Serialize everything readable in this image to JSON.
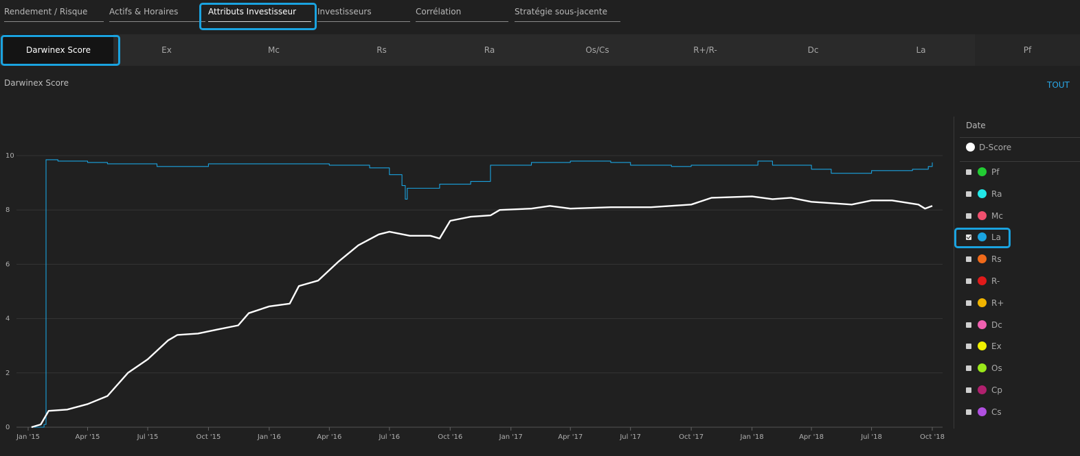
{
  "top_tabs": [
    {
      "label": "Rendement / Risque"
    },
    {
      "label": "Actifs & Horaires"
    },
    {
      "label": "Attributs Investisseur"
    },
    {
      "label": "Investisseurs"
    },
    {
      "label": "Corrélation"
    },
    {
      "label": "Stratégie sous-jacente"
    }
  ],
  "sub_tabs": [
    {
      "label": "Darwinex Score"
    },
    {
      "label": "Ex"
    },
    {
      "label": "Mc"
    },
    {
      "label": "Rs"
    },
    {
      "label": "Ra"
    },
    {
      "label": "Os/Cs"
    },
    {
      "label": "R+/R-"
    },
    {
      "label": "Dc"
    },
    {
      "label": "La"
    },
    {
      "label": "Pf"
    }
  ],
  "chart_panel": {
    "title": "Darwinex Score",
    "tout_label": "TOUT"
  },
  "legend": {
    "date_label": "Date",
    "dscore_label": "D-Score",
    "items": [
      {
        "label": "Pf",
        "color": "#22cc33",
        "checked": false
      },
      {
        "label": "Ra",
        "color": "#22e8e8",
        "checked": false
      },
      {
        "label": "Mc",
        "color": "#f0506e",
        "checked": false
      },
      {
        "label": "La",
        "color": "#1aa3e0",
        "checked": true
      },
      {
        "label": "Rs",
        "color": "#f06a1a",
        "checked": false
      },
      {
        "label": "R-",
        "color": "#e01a1a",
        "checked": false
      },
      {
        "label": "R+",
        "color": "#f0b400",
        "checked": false
      },
      {
        "label": "Dc",
        "color": "#f060b0",
        "checked": false
      },
      {
        "label": "Ex",
        "color": "#f0f000",
        "checked": false
      },
      {
        "label": "Os",
        "color": "#9ae81a",
        "checked": false
      },
      {
        "label": "Cp",
        "color": "#b0206e",
        "checked": false
      },
      {
        "label": "Cs",
        "color": "#b050e0",
        "checked": false
      }
    ]
  },
  "chart_data": {
    "type": "line",
    "title": "Darwinex Score",
    "xlabel": "",
    "ylabel": "",
    "ylim": [
      0,
      10
    ],
    "yticks": [
      0,
      2,
      4,
      6,
      8,
      10
    ],
    "xticks": [
      "Jan '15",
      "Apr '15",
      "Jul '15",
      "Oct '15",
      "Jan '16",
      "Apr '16",
      "Jul '16",
      "Oct '16",
      "Jan '17",
      "Apr '17",
      "Jul '17",
      "Oct '17",
      "Jan '18",
      "Apr '18",
      "Jul '18",
      "Oct '18"
    ],
    "grid": true,
    "series": [
      {
        "name": "D-Score",
        "color": "#ffffff",
        "points": [
          [
            "2015-01-06",
            0.0
          ],
          [
            "2015-01-20",
            0.1
          ],
          [
            "2015-02-01",
            0.6
          ],
          [
            "2015-03-01",
            0.65
          ],
          [
            "2015-04-01",
            0.85
          ],
          [
            "2015-05-01",
            1.15
          ],
          [
            "2015-06-01",
            2.0
          ],
          [
            "2015-07-01",
            2.5
          ],
          [
            "2015-08-01",
            3.2
          ],
          [
            "2015-08-15",
            3.4
          ],
          [
            "2015-09-15",
            3.45
          ],
          [
            "2015-10-15",
            3.6
          ],
          [
            "2015-11-15",
            3.75
          ],
          [
            "2015-12-01",
            4.2
          ],
          [
            "2016-01-01",
            4.45
          ],
          [
            "2016-02-01",
            4.55
          ],
          [
            "2016-02-15",
            5.2
          ],
          [
            "2016-03-15",
            5.4
          ],
          [
            "2016-04-15",
            6.1
          ],
          [
            "2016-05-15",
            6.7
          ],
          [
            "2016-06-15",
            7.1
          ],
          [
            "2016-07-01",
            7.2
          ],
          [
            "2016-08-01",
            7.05
          ],
          [
            "2016-09-01",
            7.05
          ],
          [
            "2016-09-15",
            6.95
          ],
          [
            "2016-10-01",
            7.6
          ],
          [
            "2016-11-01",
            7.75
          ],
          [
            "2016-12-01",
            7.8
          ],
          [
            "2016-12-15",
            8.0
          ],
          [
            "2017-02-01",
            8.05
          ],
          [
            "2017-03-01",
            8.15
          ],
          [
            "2017-04-01",
            8.05
          ],
          [
            "2017-06-01",
            8.1
          ],
          [
            "2017-08-01",
            8.1
          ],
          [
            "2017-10-01",
            8.2
          ],
          [
            "2017-11-01",
            8.45
          ],
          [
            "2018-01-01",
            8.5
          ],
          [
            "2018-02-01",
            8.4
          ],
          [
            "2018-03-01",
            8.45
          ],
          [
            "2018-04-01",
            8.3
          ],
          [
            "2018-06-01",
            8.2
          ],
          [
            "2018-07-01",
            8.35
          ],
          [
            "2018-08-01",
            8.35
          ],
          [
            "2018-09-10",
            8.2
          ],
          [
            "2018-09-20",
            8.05
          ],
          [
            "2018-10-01",
            8.15
          ]
        ]
      },
      {
        "name": "La",
        "color": "#1aa3e0",
        "points": [
          [
            "2015-01-06",
            0.0
          ],
          [
            "2015-01-25",
            0.1
          ],
          [
            "2015-01-28",
            9.85
          ],
          [
            "2015-02-15",
            9.8
          ],
          [
            "2015-04-01",
            9.75
          ],
          [
            "2015-05-01",
            9.7
          ],
          [
            "2015-07-01",
            9.7
          ],
          [
            "2015-07-15",
            9.6
          ],
          [
            "2015-09-01",
            9.6
          ],
          [
            "2015-10-01",
            9.7
          ],
          [
            "2015-12-01",
            9.7
          ],
          [
            "2016-04-01",
            9.65
          ],
          [
            "2016-06-01",
            9.55
          ],
          [
            "2016-07-01",
            9.3
          ],
          [
            "2016-07-20",
            8.9
          ],
          [
            "2016-07-25",
            8.4
          ],
          [
            "2016-07-28",
            8.8
          ],
          [
            "2016-09-01",
            8.8
          ],
          [
            "2016-09-15",
            8.95
          ],
          [
            "2016-11-01",
            9.05
          ],
          [
            "2016-12-01",
            9.65
          ],
          [
            "2017-02-01",
            9.75
          ],
          [
            "2017-04-01",
            9.8
          ],
          [
            "2017-06-01",
            9.75
          ],
          [
            "2017-07-01",
            9.65
          ],
          [
            "2017-09-01",
            9.6
          ],
          [
            "2017-10-01",
            9.65
          ],
          [
            "2017-12-01",
            9.65
          ],
          [
            "2018-01-10",
            9.8
          ],
          [
            "2018-02-01",
            9.65
          ],
          [
            "2018-04-01",
            9.5
          ],
          [
            "2018-05-01",
            9.35
          ],
          [
            "2018-07-01",
            9.45
          ],
          [
            "2018-09-01",
            9.5
          ],
          [
            "2018-09-25",
            9.6
          ],
          [
            "2018-10-01",
            9.75
          ]
        ]
      }
    ]
  }
}
